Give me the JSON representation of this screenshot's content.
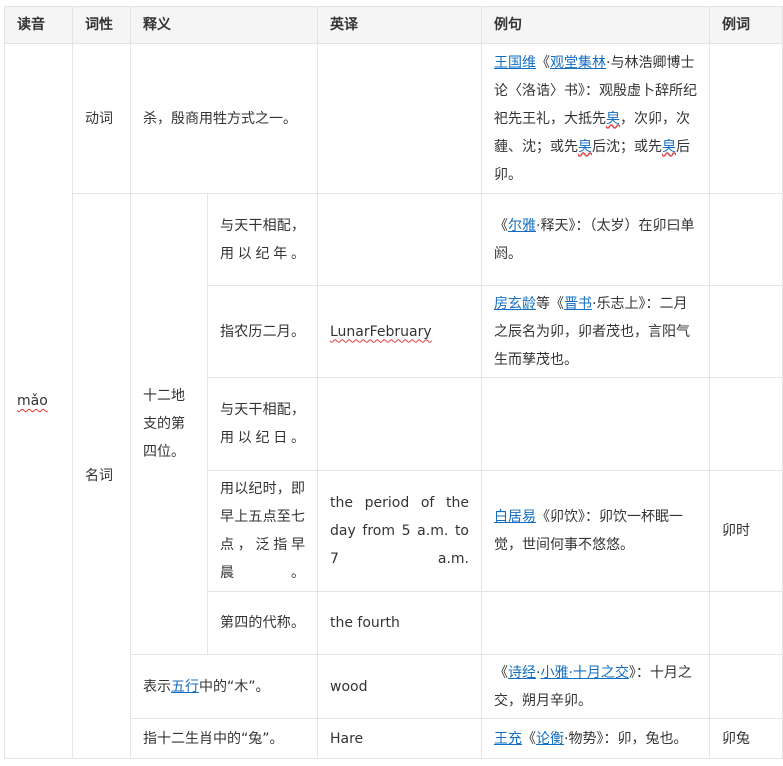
{
  "headers": [
    "读音",
    "词性",
    "释义",
    "英译",
    "例句",
    "例词"
  ],
  "reading": "mǎo",
  "verb": {
    "pos": "动词",
    "meaning": "杀，殷商用牲方式之一。",
    "example": {
      "author": "王国维",
      "open": "《",
      "work": "观堂集林",
      "rest1": "·与林浩卿博士论〈洛诰〉书》：观殷虚卜辞所纪祀先王礼，大抵先",
      "char1": "㚖",
      "rest2": "，次卯，次薶、沈；或先",
      "char2": "㚖",
      "rest3": "后沈；或先",
      "char3": "㚖",
      "rest4": "后卯。"
    }
  },
  "noun": {
    "pos": "名词",
    "branch": "十二地支的第四位。",
    "rows": [
      {
        "sub": "与天干相配，用以纪年。",
        "en": "",
        "ex_open": "《",
        "ex_link": "尔雅",
        "ex_rest": "·释天》：（太岁）在卯曰单阏。"
      },
      {
        "sub": "指农历二月。",
        "en": "LunarFebruary",
        "ex_link": "房玄龄",
        "ex_mid": "等《",
        "ex_link2": "晋书",
        "ex_rest": "·乐志上》：二月之辰名为卯，卯者茂也，言阳气生而孳茂也。"
      },
      {
        "sub": "与天干相配，用以纪日。",
        "en": "",
        "ex": ""
      },
      {
        "sub": "用以纪时，即早上五点至七点，泛指早晨。",
        "en": "the period of the day from 5 a.m. to 7 a.m.",
        "ex_link": "白居易",
        "ex_rest": "《卯饮》：卯饮一杯眠一觉，世间何事不悠悠。",
        "word": "卯时"
      },
      {
        "sub": "第四的代称。",
        "en": "the fourth",
        "ex": ""
      }
    ],
    "wuxing": {
      "pre": "表示",
      "link": "五行",
      "post": "中的“木”。",
      "en": "wood",
      "ex_open": "《",
      "ex_link": "诗经",
      "ex_dot": "·",
      "ex_link2": "小雅·十月之交",
      "ex_rest": "》：十月之交，朔月辛卯。"
    },
    "zodiac": {
      "meaning": "指十二生肖中的“兔”。",
      "en": "Hare",
      "ex_link": "王充",
      "ex_open": "《",
      "ex_link2": "论衡",
      "ex_rest": "·物势》：卯，兔也。",
      "word": "卯兔"
    }
  }
}
